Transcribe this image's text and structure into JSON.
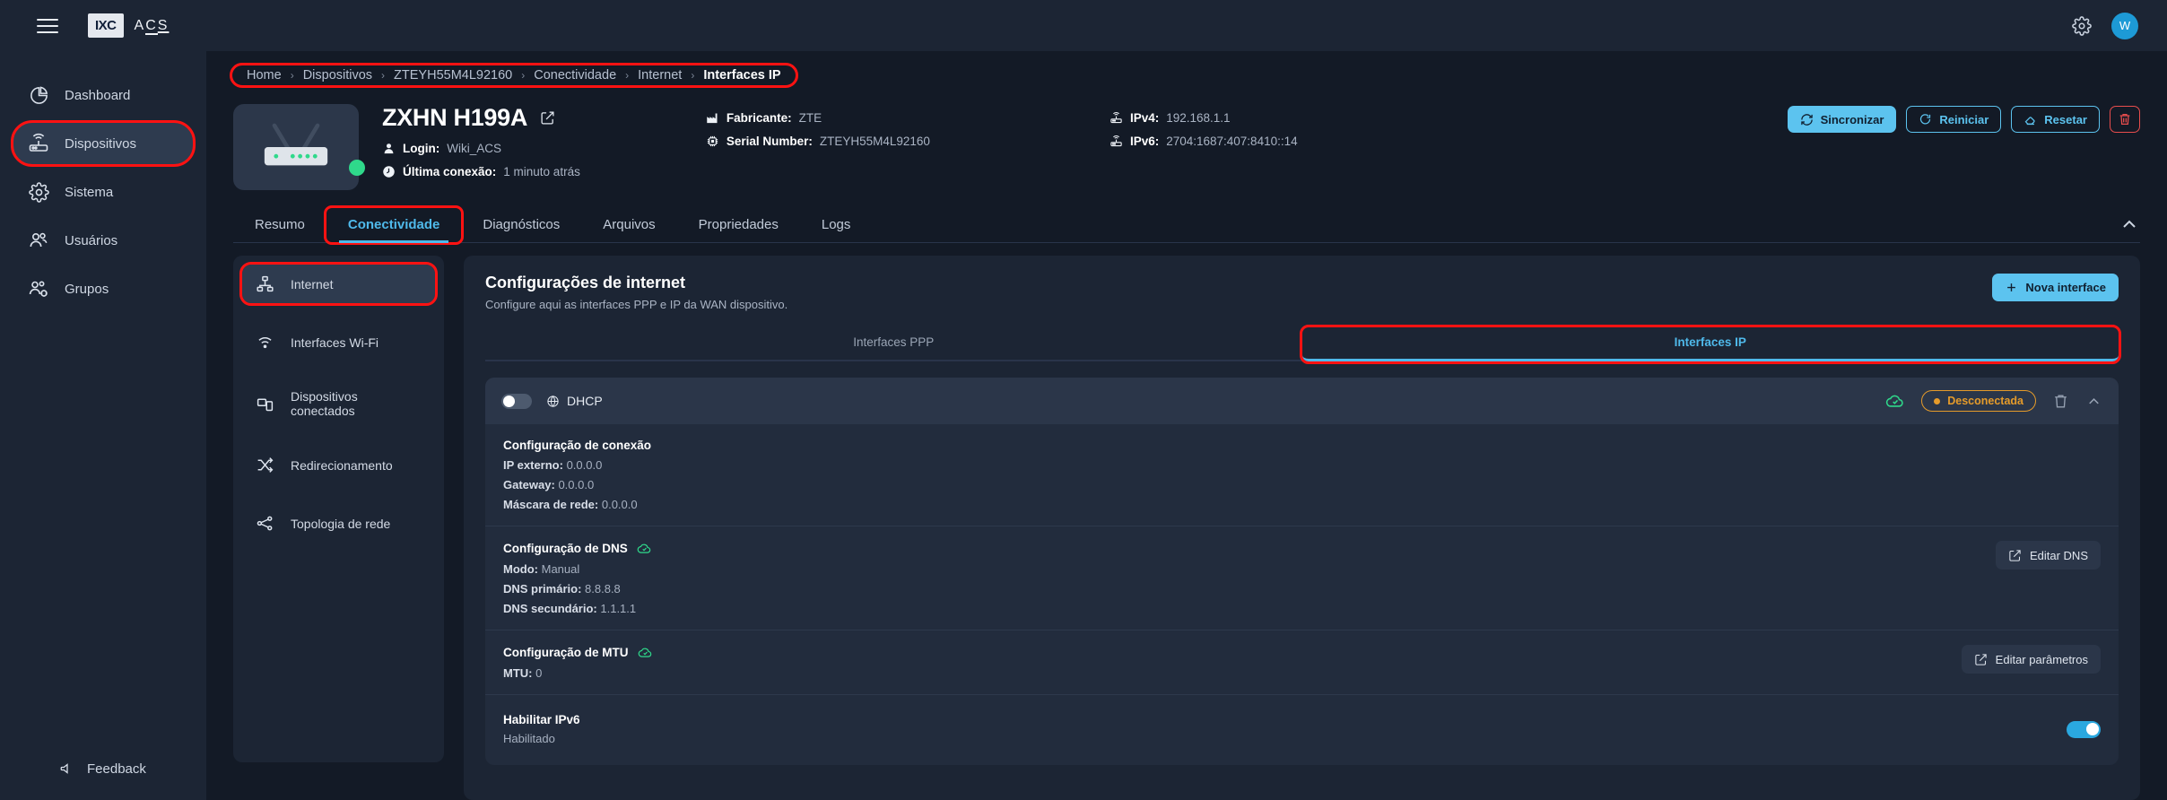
{
  "topbar": {
    "menu_icon": "hamburger-icon",
    "logo_text": "IXC",
    "brand_text": "ACS",
    "settings_icon": "gear-icon",
    "avatar_initial": "W"
  },
  "sidebar": {
    "items": [
      {
        "label": "Dashboard",
        "icon": "pie-chart-icon",
        "active": false
      },
      {
        "label": "Dispositivos",
        "icon": "router-icon",
        "active": true
      },
      {
        "label": "Sistema",
        "icon": "gear-icon",
        "active": false
      },
      {
        "label": "Usuários",
        "icon": "users-icon",
        "active": false
      },
      {
        "label": "Grupos",
        "icon": "user-group-settings-icon",
        "active": false
      }
    ],
    "feedback_label": "Feedback",
    "feedback_icon": "megaphone-icon"
  },
  "breadcrumb": {
    "items": [
      "Home",
      "Dispositivos",
      "ZTEYH55M4L92160",
      "Conectividade",
      "Internet",
      "Interfaces IP"
    ],
    "separator": "›"
  },
  "device": {
    "title": "ZXHN H199A",
    "edit_icon": "pencil-square-icon",
    "status_dot_color": "#2fd98b",
    "login_label": "Login:",
    "login_value": "Wiki_ACS",
    "last_conn_label": "Última conexão:",
    "last_conn_value": "1 minuto atrás",
    "manufacturer_label": "Fabricante:",
    "manufacturer_value": "ZTE",
    "serial_label": "Serial Number:",
    "serial_value": "ZTEYH55M4L92160",
    "ipv4_label": "IPv4:",
    "ipv4_value": "192.168.1.1",
    "ipv6_label": "IPv6:",
    "ipv6_value": "2704:1687:407:8410::14",
    "actions": {
      "sync_label": "Sincronizar",
      "restart_label": "Reiniciar",
      "reset_label": "Resetar",
      "delete_icon": "trash-icon"
    }
  },
  "tabs": [
    {
      "label": "Resumo",
      "active": false
    },
    {
      "label": "Conectividade",
      "active": true
    },
    {
      "label": "Diagnósticos",
      "active": false
    },
    {
      "label": "Arquivos",
      "active": false
    },
    {
      "label": "Propriedades",
      "active": false
    },
    {
      "label": "Logs",
      "active": false
    }
  ],
  "collapse_icon": "chevron-double-up-icon",
  "subnav": {
    "items": [
      {
        "label": "Internet",
        "icon": "network-icon",
        "active": true
      },
      {
        "label": "Interfaces Wi-Fi",
        "icon": "wifi-icon",
        "active": false
      },
      {
        "label": "Dispositivos conectados",
        "icon": "devices-icon",
        "active": false
      },
      {
        "label": "Redirecionamento",
        "icon": "shuffle-icon",
        "active": false
      },
      {
        "label": "Topologia de rede",
        "icon": "topology-icon",
        "active": false
      }
    ]
  },
  "panel": {
    "title": "Configurações de internet",
    "subtitle": "Configure aqui as interfaces PPP e IP da WAN dispositivo.",
    "new_interface_label": "Nova interface",
    "new_interface_icon": "plus-icon",
    "segments": [
      {
        "label": "Interfaces PPP",
        "active": false
      },
      {
        "label": "Interfaces IP",
        "active": true
      }
    ]
  },
  "interface_card": {
    "toggle_on": false,
    "globe_icon": "globe-icon",
    "name": "DHCP",
    "cloud_icon": "cloud-check-icon",
    "status_label": "Desconectada",
    "status_color": "#e59b2a",
    "delete_icon": "trash-icon",
    "collapse_icon": "chevron-up-icon",
    "sections": {
      "connection": {
        "title": "Configuração de conexão",
        "rows": [
          {
            "key": "IP externo:",
            "value": "0.0.0.0"
          },
          {
            "key": "Gateway:",
            "value": "0.0.0.0"
          },
          {
            "key": "Máscara de rede:",
            "value": "0.0.0.0"
          }
        ]
      },
      "dns": {
        "title": "Configuração de DNS",
        "cloud_icon": "cloud-check-icon",
        "rows": [
          {
            "key": "Modo:",
            "value": "Manual"
          },
          {
            "key": "DNS primário:",
            "value": "8.8.8.8"
          },
          {
            "key": "DNS secundário:",
            "value": "1.1.1.1"
          }
        ],
        "button_label": "Editar DNS",
        "button_icon": "pencil-square-icon"
      },
      "mtu": {
        "title": "Configuração de MTU",
        "cloud_icon": "cloud-check-icon",
        "rows": [
          {
            "key": "MTU:",
            "value": "0"
          }
        ],
        "button_label": "Editar parâmetros",
        "button_icon": "pencil-square-icon"
      },
      "ipv6": {
        "title": "Habilitar IPv6",
        "status": "Habilitado",
        "toggle_on": true
      }
    }
  },
  "colors": {
    "accent": "#4fb9ea",
    "primary_btn": "#5cc3ef",
    "danger": "#e84d4d",
    "warning": "#e59b2a",
    "success": "#2fd98b",
    "highlight_ring": "#ff1212",
    "bg": "#131a26",
    "panel_bg": "#1c2534",
    "card_bg": "#222c3d"
  }
}
